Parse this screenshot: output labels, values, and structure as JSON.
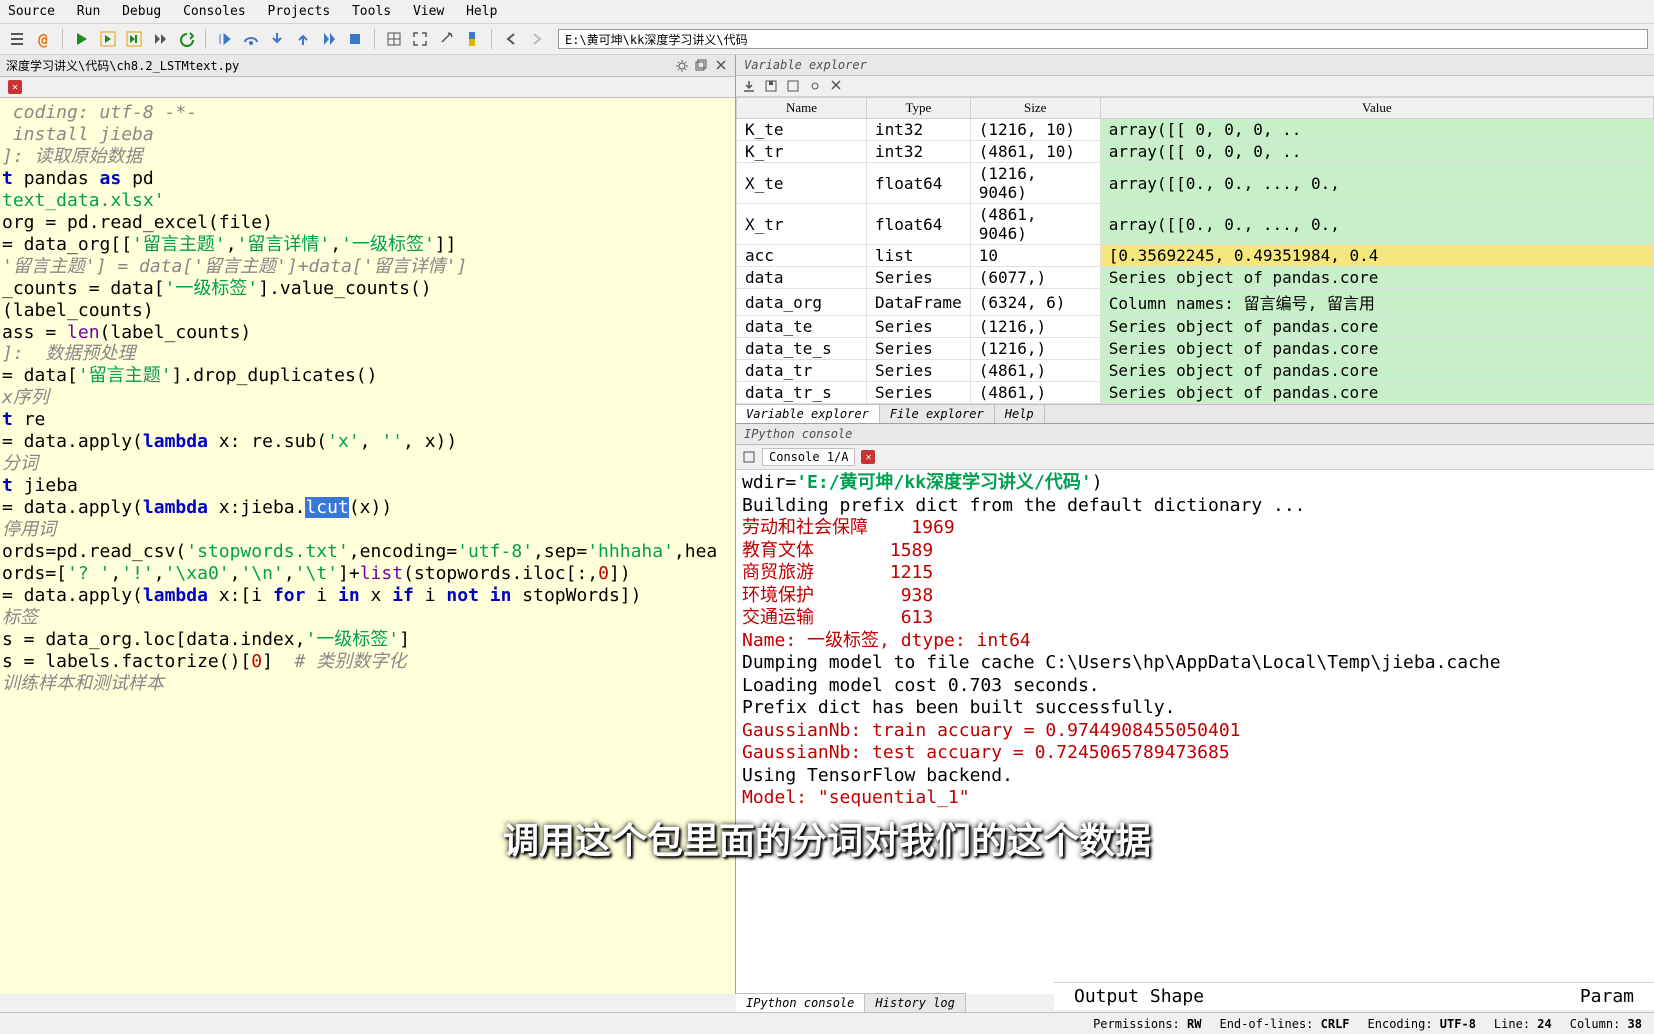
{
  "menu": [
    "Source",
    "Run",
    "Debug",
    "Consoles",
    "Projects",
    "Tools",
    "View",
    "Help"
  ],
  "path": "E:\\黄可坤\\kk深度学习讲义\\代码",
  "file_path": "深度学习讲义\\代码\\ch8.2_LSTMtext.py",
  "editor_lines": [
    {
      "segs": [
        {
          "t": " coding: utf-8 -*-",
          "cls": "c-comment"
        }
      ]
    },
    {
      "segs": [
        {
          "t": " install jieba",
          "cls": "c-comment"
        }
      ]
    },
    {
      "segs": [
        {
          "t": ""
        }
      ]
    },
    {
      "segs": [
        {
          "t": "]: 读取原始数据",
          "cls": "c-comment"
        }
      ]
    },
    {
      "segs": [
        {
          "t": "t ",
          "cls": "c-kw"
        },
        {
          "t": "pandas "
        },
        {
          "t": "as ",
          "cls": "c-kw"
        },
        {
          "t": "pd"
        }
      ]
    },
    {
      "segs": [
        {
          "t": "text_data.xlsx'",
          "cls": "c-str"
        }
      ]
    },
    {
      "segs": [
        {
          "t": "org = pd.read_excel(file)"
        }
      ]
    },
    {
      "segs": [
        {
          "t": "= data_org[["
        },
        {
          "t": "'留言主题'",
          "cls": "c-str"
        },
        {
          "t": ","
        },
        {
          "t": "'留言详情'",
          "cls": "c-str"
        },
        {
          "t": ","
        },
        {
          "t": "'一级标签'",
          "cls": "c-str"
        },
        {
          "t": "]]"
        }
      ]
    },
    {
      "segs": [
        {
          "t": "'留言主题'] = data['留言主题']+data['留言详情']",
          "cls": "c-comment"
        }
      ]
    },
    {
      "segs": [
        {
          "t": "_counts = data["
        },
        {
          "t": "'一级标签'",
          "cls": "c-str"
        },
        {
          "t": "].value_counts()"
        }
      ]
    },
    {
      "segs": [
        {
          "t": "(label_counts)"
        }
      ]
    },
    {
      "segs": [
        {
          "t": "ass = "
        },
        {
          "t": "len",
          "cls": "c-builtin"
        },
        {
          "t": "(label_counts)"
        }
      ]
    },
    {
      "segs": [
        {
          "t": ""
        }
      ]
    },
    {
      "segs": [
        {
          "t": "]:  数据预处理",
          "cls": "c-comment"
        }
      ]
    },
    {
      "segs": [
        {
          "t": ""
        }
      ]
    },
    {
      "segs": [
        {
          "t": "= data["
        },
        {
          "t": "'留言主题'",
          "cls": "c-str"
        },
        {
          "t": "].drop_duplicates()"
        }
      ]
    },
    {
      "segs": [
        {
          "t": ""
        }
      ]
    },
    {
      "segs": [
        {
          "t": "x序列",
          "cls": "c-comment"
        }
      ]
    },
    {
      "segs": [
        {
          "t": "t ",
          "cls": "c-kw"
        },
        {
          "t": "re"
        }
      ]
    },
    {
      "segs": [
        {
          "t": "= data.apply("
        },
        {
          "t": "lambda",
          "cls": "c-kw"
        },
        {
          "t": " x: re.sub("
        },
        {
          "t": "'x'",
          "cls": "c-str"
        },
        {
          "t": ", "
        },
        {
          "t": "''",
          "cls": "c-str"
        },
        {
          "t": ", x))"
        }
      ]
    },
    {
      "segs": [
        {
          "t": ""
        }
      ]
    },
    {
      "segs": [
        {
          "t": "分词",
          "cls": "c-comment"
        }
      ]
    },
    {
      "segs": [
        {
          "t": "t ",
          "cls": "c-kw"
        },
        {
          "t": "jieba"
        }
      ]
    },
    {
      "segs": [
        {
          "t": "= data.apply("
        },
        {
          "t": "lambda",
          "cls": "c-kw"
        },
        {
          "t": " x:jieba."
        },
        {
          "t": "lcut",
          "cls": "hl"
        },
        {
          "t": "(x))"
        }
      ]
    },
    {
      "segs": [
        {
          "t": ""
        }
      ]
    },
    {
      "segs": [
        {
          "t": "停用词",
          "cls": "c-comment"
        }
      ]
    },
    {
      "segs": [
        {
          "t": "ords=pd.read_csv("
        },
        {
          "t": "'stopwords.txt'",
          "cls": "c-str"
        },
        {
          "t": ",encoding="
        },
        {
          "t": "'utf-8'",
          "cls": "c-str"
        },
        {
          "t": ",sep="
        },
        {
          "t": "'hhhaha'",
          "cls": "c-str"
        },
        {
          "t": ",hea"
        }
      ]
    },
    {
      "segs": [
        {
          "t": "ords=["
        },
        {
          "t": "'? '",
          "cls": "c-str"
        },
        {
          "t": ","
        },
        {
          "t": "'!'",
          "cls": "c-str"
        },
        {
          "t": ","
        },
        {
          "t": "'\\xa0'",
          "cls": "c-str"
        },
        {
          "t": ","
        },
        {
          "t": "'\\n'",
          "cls": "c-str"
        },
        {
          "t": ","
        },
        {
          "t": "'\\t'",
          "cls": "c-str"
        },
        {
          "t": "]+"
        },
        {
          "t": "list",
          "cls": "c-builtin"
        },
        {
          "t": "(stopwords.iloc[:,"
        },
        {
          "t": "0",
          "cls": "c-num"
        },
        {
          "t": "])"
        }
      ]
    },
    {
      "segs": [
        {
          "t": "= data.apply("
        },
        {
          "t": "lambda",
          "cls": "c-kw"
        },
        {
          "t": " x:[i "
        },
        {
          "t": "for",
          "cls": "c-kw"
        },
        {
          "t": " i "
        },
        {
          "t": "in",
          "cls": "c-kw"
        },
        {
          "t": " x "
        },
        {
          "t": "if",
          "cls": "c-kw"
        },
        {
          "t": " i "
        },
        {
          "t": "not",
          "cls": "c-kw"
        },
        {
          "t": " "
        },
        {
          "t": "in",
          "cls": "c-kw"
        },
        {
          "t": " stopWords])"
        }
      ]
    },
    {
      "segs": [
        {
          "t": ""
        }
      ]
    },
    {
      "segs": [
        {
          "t": "标签",
          "cls": "c-comment"
        }
      ]
    },
    {
      "segs": [
        {
          "t": "s = data_org.loc[data.index,"
        },
        {
          "t": "'一级标签'",
          "cls": "c-str"
        },
        {
          "t": "]"
        }
      ]
    },
    {
      "segs": [
        {
          "t": "s = labels.factorize()["
        },
        {
          "t": "0",
          "cls": "c-num"
        },
        {
          "t": "]  "
        },
        {
          "t": "# 类别数字化",
          "cls": "c-comment"
        }
      ]
    },
    {
      "segs": [
        {
          "t": ""
        }
      ]
    },
    {
      "segs": [
        {
          "t": "训练样本和测试样本",
          "cls": "c-comment"
        }
      ]
    }
  ],
  "var_pane_title": "Variable explorer",
  "var_headers": [
    "Name",
    "Type",
    "Size",
    "Value"
  ],
  "variables": [
    {
      "name": "K_te",
      "type": "int32",
      "size": "(1216, 10)",
      "value": "array([[   0,   0,   0, ..",
      "cls": ""
    },
    {
      "name": "K_tr",
      "type": "int32",
      "size": "(4861, 10)",
      "value": "array([[   0,   0,   0, ..",
      "cls": ""
    },
    {
      "name": "X_te",
      "type": "float64",
      "size": "(1216, 9046)",
      "value": "array([[0.,  0., ..., 0.,",
      "cls": ""
    },
    {
      "name": "X_tr",
      "type": "float64",
      "size": "(4861, 9046)",
      "value": "array([[0.,  0., ..., 0.,",
      "cls": ""
    },
    {
      "name": "acc",
      "type": "list",
      "size": "10",
      "value": "[0.35692245, 0.49351984, 0.4",
      "cls": "yellow"
    },
    {
      "name": "data",
      "type": "Series",
      "size": "(6077,)",
      "value": "Series object of pandas.core",
      "cls": ""
    },
    {
      "name": "data_org",
      "type": "DataFrame",
      "size": "(6324, 6)",
      "value": "Column names: 留言编号, 留言用",
      "cls": ""
    },
    {
      "name": "data_te",
      "type": "Series",
      "size": "(1216,)",
      "value": "Series object of pandas.core",
      "cls": ""
    },
    {
      "name": "data_te_s",
      "type": "Series",
      "size": "(1216,)",
      "value": "Series object of pandas.core",
      "cls": ""
    },
    {
      "name": "data_tr",
      "type": "Series",
      "size": "(4861,)",
      "value": "Series object of pandas.core",
      "cls": ""
    },
    {
      "name": "data_tr_s",
      "type": "Series",
      "size": "(4861,)",
      "value": "Series object of pandas.core",
      "cls": ""
    }
  ],
  "bottom_tabs": [
    "Variable explorer",
    "File explorer",
    "Help"
  ],
  "ipy_title": "IPython console",
  "console_tab": "Console 1/A",
  "console_lines": [
    {
      "t": "wdir='E:/黄可坤/kk深度学习讲义/代码')",
      "green": true
    },
    {
      "t": "Building prefix dict from the default dictionary ..."
    },
    {
      "t": "劳动和社会保障    1969",
      "red": true
    },
    {
      "t": "教育文体       1589",
      "red": true
    },
    {
      "t": "商贸旅游       1215",
      "red": true
    },
    {
      "t": "环境保护        938",
      "red": true
    },
    {
      "t": "交通运输        613",
      "red": true
    },
    {
      "t": "Name: 一级标签, dtype: int64",
      "red": true
    },
    {
      "t": "Dumping model to file cache C:\\Users\\hp\\AppData\\Local\\Temp\\jieba.cache"
    },
    {
      "t": "Loading model cost 0.703 seconds."
    },
    {
      "t": "Prefix dict has been built successfully."
    },
    {
      "t": "GaussianNb: train accuary = 0.9744908455050401",
      "red": true
    },
    {
      "t": "GaussianNb: test accuary = 0.7245065789473685",
      "red": true
    },
    {
      "t": "Using TensorFlow backend."
    },
    {
      "t": "Model: \"sequential_1\"",
      "red": true
    }
  ],
  "output_shape_label": "Output Shape",
  "param_label": "Param",
  "console_bottom_tabs": [
    "IPython console",
    "History log"
  ],
  "status": {
    "perm_l": "Permissions:",
    "perm_v": "RW",
    "eol_l": "End-of-lines:",
    "eol_v": "CRLF",
    "enc_l": "Encoding:",
    "enc_v": "UTF-8",
    "line_l": "Line:",
    "line_v": "24",
    "col_l": "Column:",
    "col_v": "38"
  },
  "subtitle": "调用这个包里面的分词对我们的这个数据"
}
